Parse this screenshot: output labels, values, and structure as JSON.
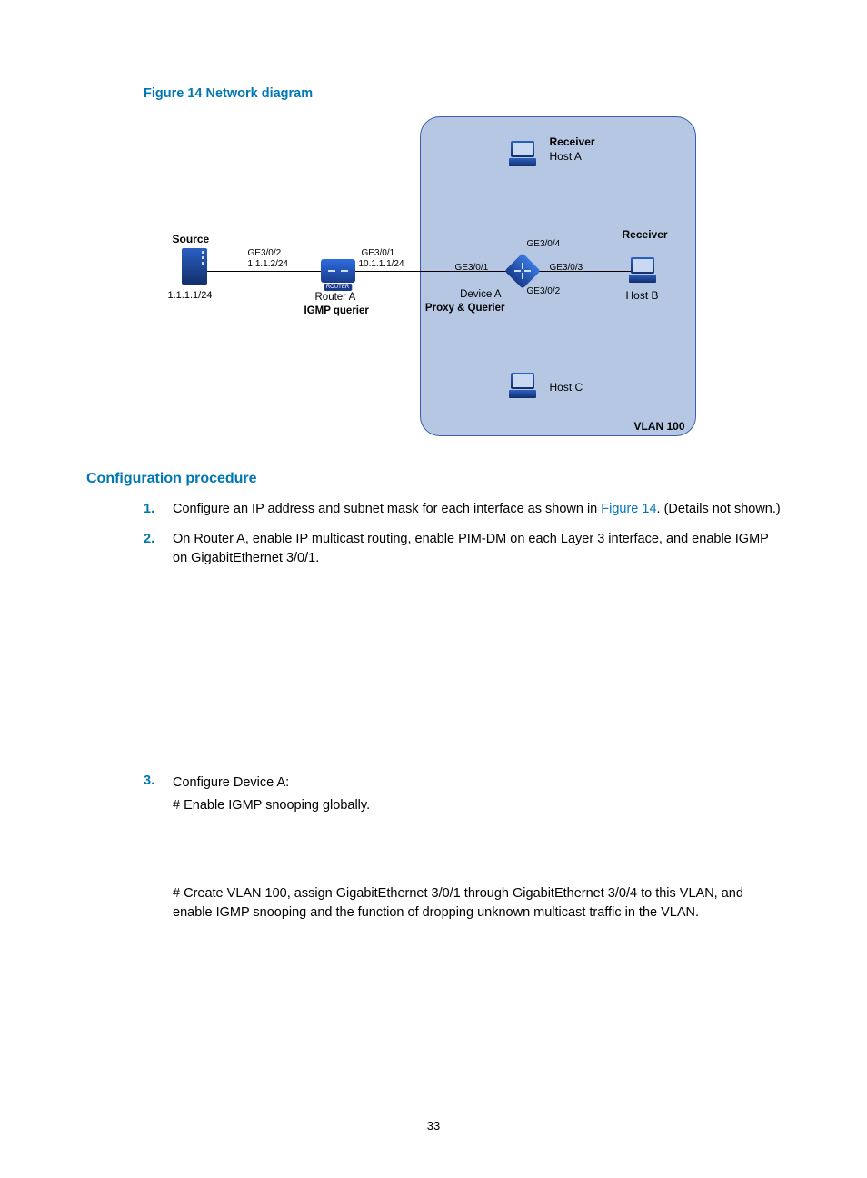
{
  "figure": {
    "title": "Figure 14 Network diagram",
    "vlan_label": "VLAN 100",
    "nodes": {
      "source": {
        "title": "Source",
        "ip": "1.1.1.1/24"
      },
      "router_a": {
        "name": "Router A",
        "role": "IGMP querier",
        "port_left_if": "GE3/0/2",
        "port_left_ip": "1.1.1.2/24",
        "port_right_if": "GE3/0/1",
        "port_right_ip": "10.1.1.1/24"
      },
      "device_a": {
        "name": "Device A",
        "role": "Proxy & Querier",
        "p1": "GE3/0/1",
        "p2": "GE3/0/2",
        "p3": "GE3/0/3",
        "p4": "GE3/0/4"
      },
      "host_a": {
        "title": "Receiver",
        "name": "Host A"
      },
      "host_b": {
        "title": "Receiver",
        "name": "Host B"
      },
      "host_c": {
        "name": "Host C"
      }
    }
  },
  "section": "Configuration procedure",
  "steps": {
    "s1_pre": "Configure an IP address and subnet mask for each interface as shown in ",
    "s1_link": "Figure 14",
    "s1_post": ". (Details not shown.)",
    "s2": "On Router A, enable IP multicast routing, enable PIM-DM on each Layer 3 interface, and enable IGMP on GigabitEthernet 3/0/1.",
    "s3": "Configure Device A:",
    "s3a": "# Enable IGMP snooping globally.",
    "s3b": "# Create VLAN 100, assign GigabitEthernet 3/0/1 through GigabitEthernet 3/0/4 to this VLAN, and enable IGMP snooping and the function of dropping unknown multicast traffic in the VLAN."
  },
  "page_number": "33"
}
